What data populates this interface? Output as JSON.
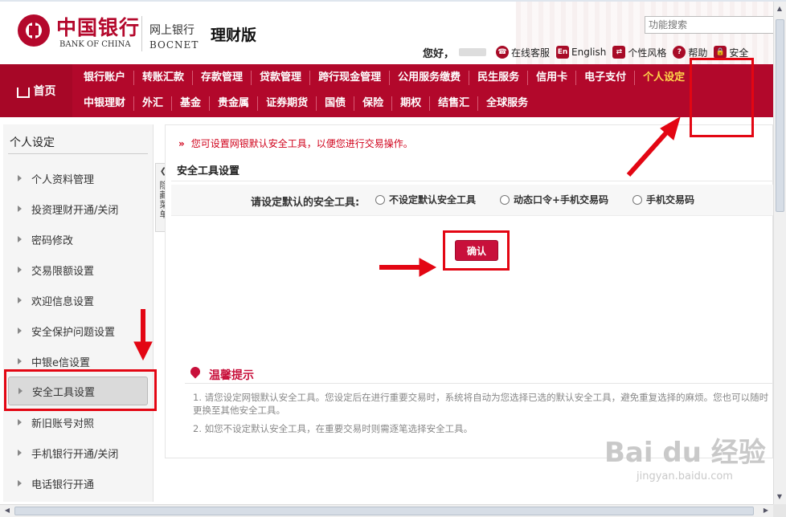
{
  "header": {
    "logo_cn": "中国银行",
    "logo_en": "BANK OF CHINA",
    "bank_cn": "网上银行",
    "bank_en": "BOCNET",
    "edition": "理财版",
    "search_placeholder": "功能搜索",
    "greeting": "您好，",
    "links": [
      {
        "label": "在线客服",
        "icon": "customer-service-icon"
      },
      {
        "label": "English",
        "icon": "en-icon"
      },
      {
        "label": "个性风格",
        "icon": "style-switch-icon"
      },
      {
        "label": "帮助",
        "icon": "help-icon"
      },
      {
        "label": "安全",
        "icon": "lock-icon"
      }
    ]
  },
  "nav": {
    "home": "首页",
    "row1": [
      "银行账户",
      "转账汇款",
      "存款管理",
      "贷款管理",
      "跨行现金管理",
      "公用服务缴费",
      "民生服务",
      "信用卡",
      "电子支付",
      "个人设定"
    ],
    "row2": [
      "中银理财",
      "外汇",
      "基金",
      "贵金属",
      "证券期货",
      "国债",
      "保险",
      "期权",
      "结售汇",
      "全球服务"
    ],
    "active": "个人设定"
  },
  "sidebar": {
    "title": "个人设定",
    "items": [
      "个人资料管理",
      "投资理财开通/关闭",
      "密码修改",
      "交易限额设置",
      "欢迎信息设置",
      "安全保护问题设置",
      "中银e信设置",
      "安全工具设置",
      "新旧账号对照",
      "手机银行开通/关闭",
      "电话银行开通"
    ],
    "active": "安全工具设置",
    "collapse_label": "隐藏菜单"
  },
  "main": {
    "notice": "您可设置网银默认安全工具，以便您进行交易操作。",
    "section_title": "安全工具设置",
    "tool_label": "请设定默认的安全工具:",
    "options": [
      "不设定默认安全工具",
      "动态口令+手机交易码",
      "手机交易码"
    ],
    "confirm": "确认",
    "tips_title": "温馨提示",
    "tips": [
      "1. 请您设定网银默认安全工具。您设定后在进行重要交易时，系统将自动为您选择已选的默认安全工具，避免重复选择的麻烦。您也可以随时更换至其他安全工具。",
      "2. 如您不设定默认安全工具，在重要交易时则需逐笔选择安全工具。"
    ]
  },
  "watermark": {
    "main": "Bai du 经验",
    "sub": "jingyan.baidu.com"
  },
  "colors": {
    "brand_red": "#b2082b",
    "nav_active": "#ffd84a",
    "highlight": "#e30613"
  }
}
